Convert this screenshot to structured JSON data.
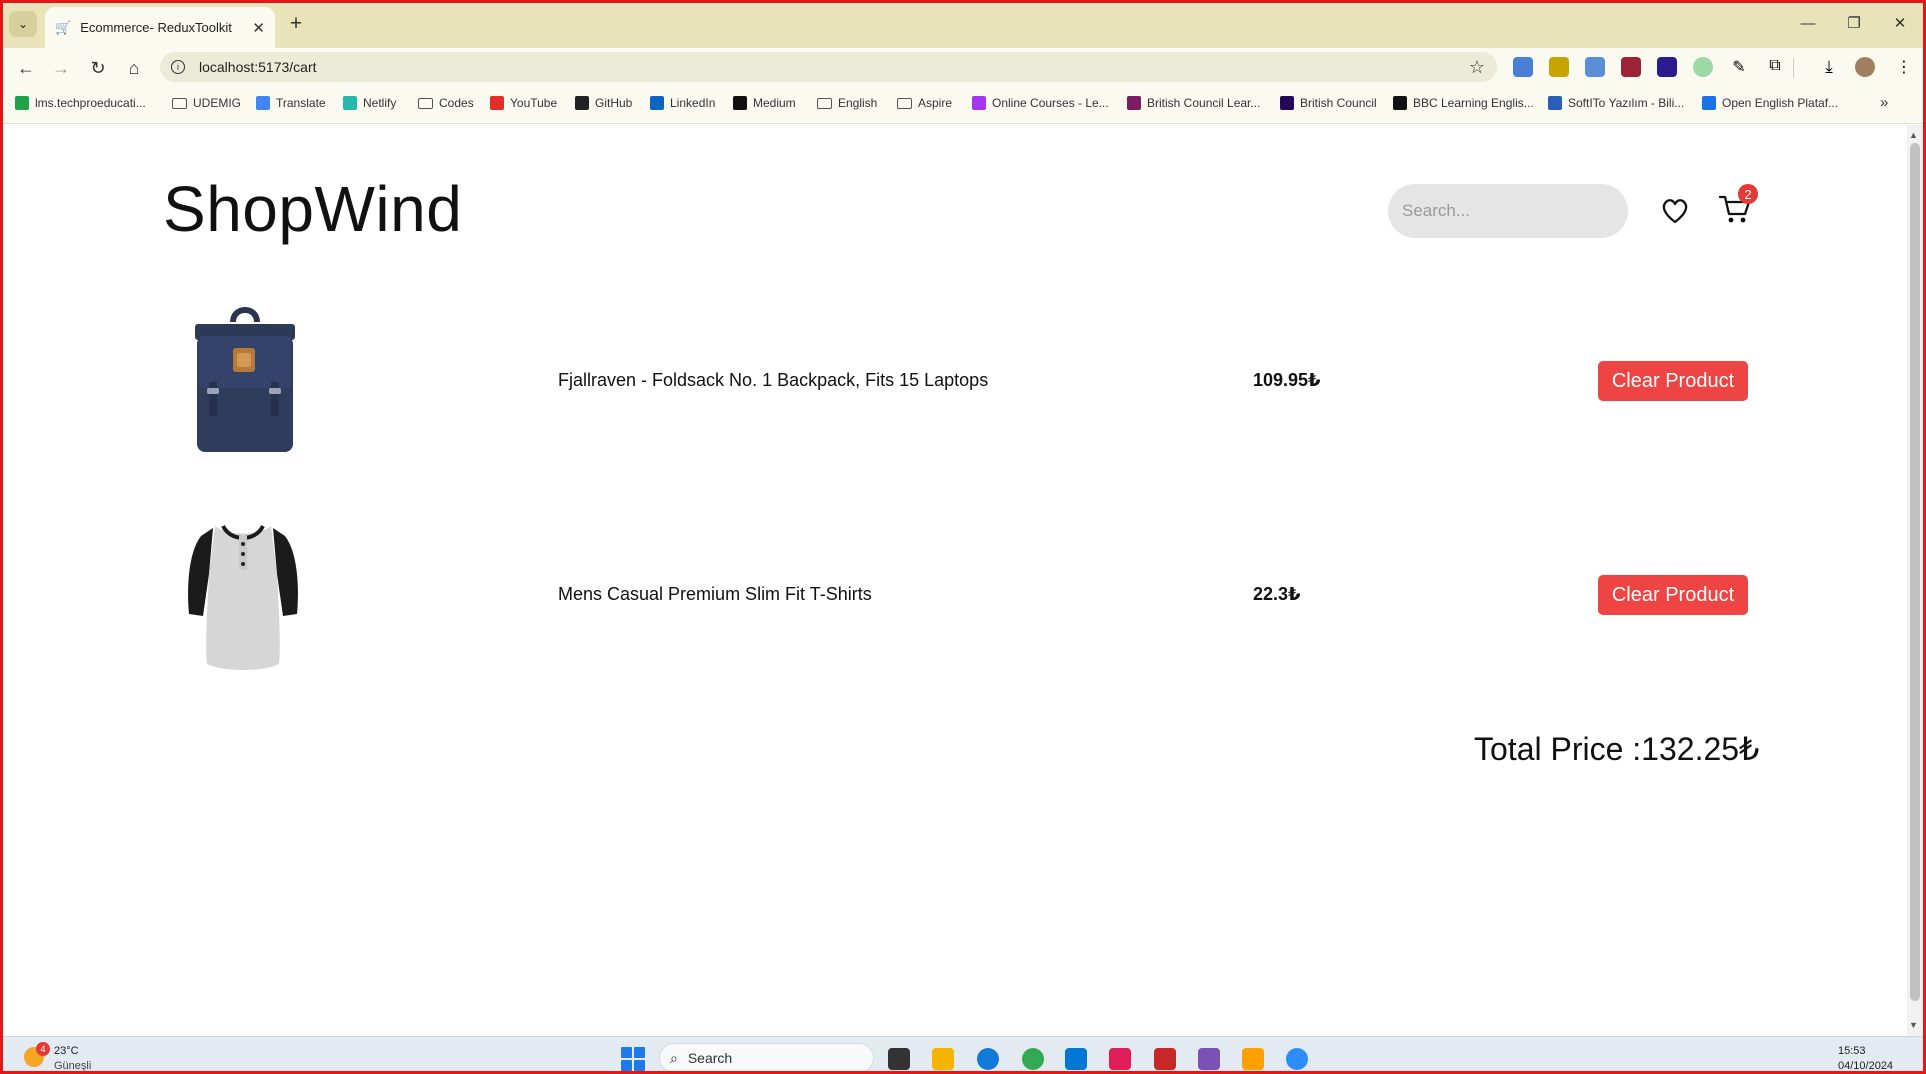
{
  "browser": {
    "tab_title": "Ecommerce- ReduxToolkit",
    "url": "localhost:5173/cart",
    "bookmarks": [
      {
        "label": "lms.techproeducati...",
        "icon": "check-icon",
        "color": "#1fa34a"
      },
      {
        "label": "UDEMIG",
        "icon": "folder-icon",
        "color": "#555555"
      },
      {
        "label": "Translate",
        "icon": "translate-icon",
        "color": "#4285f4"
      },
      {
        "label": "Netlify",
        "icon": "netlify-icon",
        "color": "#25b7a8"
      },
      {
        "label": "Codes",
        "icon": "folder-icon",
        "color": "#555555"
      },
      {
        "label": "YouTube",
        "icon": "youtube-icon",
        "color": "#e52d27"
      },
      {
        "label": "GitHub",
        "icon": "github-icon",
        "color": "#222222"
      },
      {
        "label": "LinkedIn",
        "icon": "linkedin-icon",
        "color": "#0a66c2"
      },
      {
        "label": "Medium",
        "icon": "medium-icon",
        "color": "#111111"
      },
      {
        "label": "English",
        "icon": "folder-icon",
        "color": "#555555"
      },
      {
        "label": "Aspire",
        "icon": "folder-icon",
        "color": "#555555"
      },
      {
        "label": "Online Courses - Le...",
        "icon": "udemy-icon",
        "color": "#a435f0"
      },
      {
        "label": "British Council Lear...",
        "icon": "british-council-icon",
        "color": "#7b1d63"
      },
      {
        "label": "British Council",
        "icon": "british-council-icon",
        "color": "#23085a"
      },
      {
        "label": "BBC Learning Englis...",
        "icon": "bbc-icon",
        "color": "#111111"
      },
      {
        "label": "SoftITo Yazılım - Bili...",
        "icon": "softito-icon",
        "color": "#2a5fb8"
      },
      {
        "label": "Open English Plataf...",
        "icon": "page-icon",
        "color": "#1a73e8"
      }
    ]
  },
  "header": {
    "brand": "ShopWind",
    "search_placeholder": "Search...",
    "cart_count": "2"
  },
  "cart": {
    "items": [
      {
        "name": "Fjallraven - Foldsack No. 1 Backpack, Fits 15 Laptops",
        "price": "109.95₺",
        "button": "Clear Product"
      },
      {
        "name": "Mens Casual Premium Slim Fit T-Shirts",
        "price": "22.3₺",
        "button": "Clear Product"
      }
    ],
    "total_label": "Total Price :",
    "total_value": "132.25₺"
  },
  "taskbar": {
    "weather_temp": "23°C",
    "weather_desc": "Güneşli",
    "weather_badge": "4",
    "search_label": "Search",
    "time": "15:53",
    "date": "04/10/2024"
  },
  "colors": {
    "danger": "#ef4444",
    "chrome": "#e8e3b8",
    "frame": "#e21818"
  }
}
